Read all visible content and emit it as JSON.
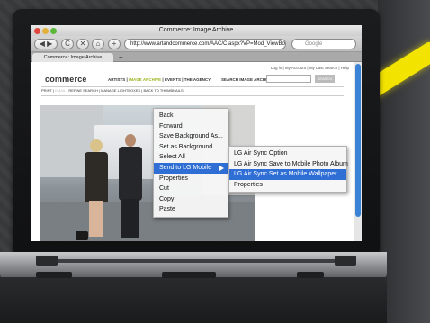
{
  "window": {
    "title": "Commerce: Image Archive"
  },
  "toolbar": {
    "back_glyph": "◀",
    "forward_glyph": "▶",
    "reload_glyph": "C",
    "stop_glyph": "✕",
    "home_glyph": "⌂",
    "add_glyph": "+",
    "url": "http://www.artandcommerce.com/AAC/C.aspx?VP=Mod_ViewBox.View",
    "search_placeholder": "Google"
  },
  "tabs": [
    {
      "label": "Commerce: Image Archive"
    }
  ],
  "tab_add_glyph": "+",
  "site": {
    "top_links": "Log in  |  My Account  |  My Last Search  |  Help",
    "logo": "commerce",
    "nav": [
      {
        "label": "ARTISTS",
        "active": false
      },
      {
        "label": "IMAGE ARCHIVE",
        "active": true
      },
      {
        "label": "EVENTS",
        "active": false
      },
      {
        "label": "THE AGENCY",
        "active": false
      }
    ],
    "nav_separator": "|",
    "search_label": "SEARCH IMAGE ARCHIVE",
    "search_button": "SEARCH",
    "subnav": [
      {
        "label": "PRINT",
        "muted": false
      },
      {
        "label": "EMAIL",
        "muted": true
      },
      {
        "label": "REFINE SEARCH",
        "muted": false
      },
      {
        "label": "MANAGE LIGHTBOXES",
        "muted": false
      },
      {
        "label": "BACK TO THUMBNAILS",
        "muted": false
      }
    ]
  },
  "context_menu": {
    "items": [
      "Back",
      "Forward",
      "Save Background As...",
      "Set as Background",
      "Select All",
      "Send to LG Mobile",
      "Properties",
      "Cut",
      "Copy",
      "Paste"
    ],
    "highlighted": "Send to LG Mobile"
  },
  "submenu": {
    "items": [
      "LG Air Sync Option",
      "LG Air Sync Save to Mobile Photo Album",
      "LG Air Sync Set as Mobile Wallpaper",
      "Properties"
    ],
    "highlighted": "LG Air Sync Set as Mobile Wallpaper"
  },
  "colors": {
    "menu_highlight": "#2f6ed4",
    "nav_active": "#9ab31c",
    "cable": "#f2e300"
  }
}
